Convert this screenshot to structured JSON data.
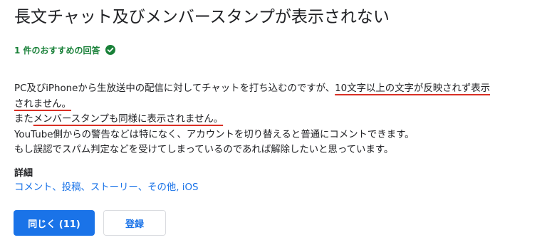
{
  "title": "長文チャット及びメンバースタンプが表示されない",
  "recommended": {
    "label": "1 件のおすすめの回答",
    "icon": "check-circle-icon",
    "color": "#188038"
  },
  "body": {
    "line1_prefix": "PC及びiPhoneから生放送中の配信に対してチャットを打ち込むのですが、",
    "line1_highlight": "10文字以上の文字が反映されず表示",
    "line2_highlight": "されません。",
    "line3_prefix": "また",
    "line3_highlight": "メンバースタンプも同様に表示されません。",
    "line4": "YouTube側からの警告などは特になく、アカウントを切り替えると普通にコメントできます。",
    "line5": "もし誤認でスパム判定などを受けてしまっているのであれば解除したいと思っています。",
    "highlight_color": "#d93025"
  },
  "details": {
    "heading": "詳細",
    "tags": [
      "コメント",
      "投稿",
      "ストーリー",
      "その他",
      "iOS"
    ],
    "sep1": "、",
    "sep2": "、",
    "sep3": "、",
    "sep4": ", "
  },
  "buttons": {
    "same_label": "同じく (11)",
    "subscribe_label": "登録",
    "primary_color": "#1a73e8"
  }
}
